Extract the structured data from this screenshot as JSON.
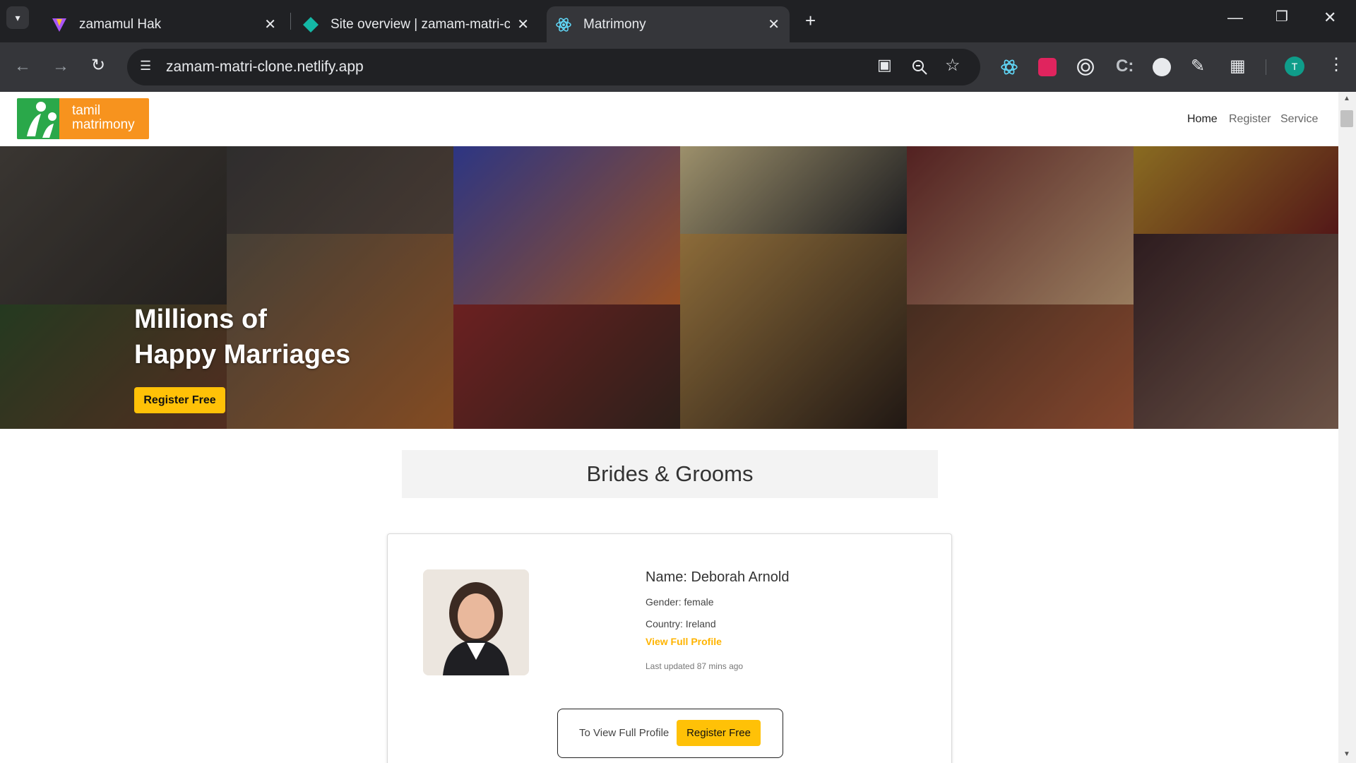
{
  "browser": {
    "tabs": [
      {
        "title": "zamamul Hak",
        "icon": "vite-icon"
      },
      {
        "title": "Site overview | zamam-matri-cl",
        "icon": "netlify-icon"
      },
      {
        "title": "Matrimony",
        "icon": "react-icon",
        "active": true
      }
    ],
    "url": "zamam-matri-clone.netlify.app",
    "profile_initial": "T"
  },
  "site": {
    "logo": {
      "line1": "tamil",
      "line2": "matrimony"
    },
    "nav": [
      "Home",
      "Register",
      "Service"
    ],
    "hero": {
      "title_line1": "Millions of",
      "title_line2": "Happy Marriages",
      "cta": "Register Free"
    },
    "section_title": "Brides & Grooms",
    "profile": {
      "name": "Name: Deborah Arnold",
      "gender": "Gender: female",
      "country": "Country: Ireland",
      "link": "View Full Profile",
      "updated": "Last updated 87 mins ago"
    },
    "register_prompt": {
      "text": "To View Full Profile",
      "button": "Register Free"
    }
  },
  "colors": {
    "accent": "#ffc107",
    "link": "#ffb400",
    "logo_orange": "#f7931e",
    "logo_green": "#2aa84a"
  }
}
